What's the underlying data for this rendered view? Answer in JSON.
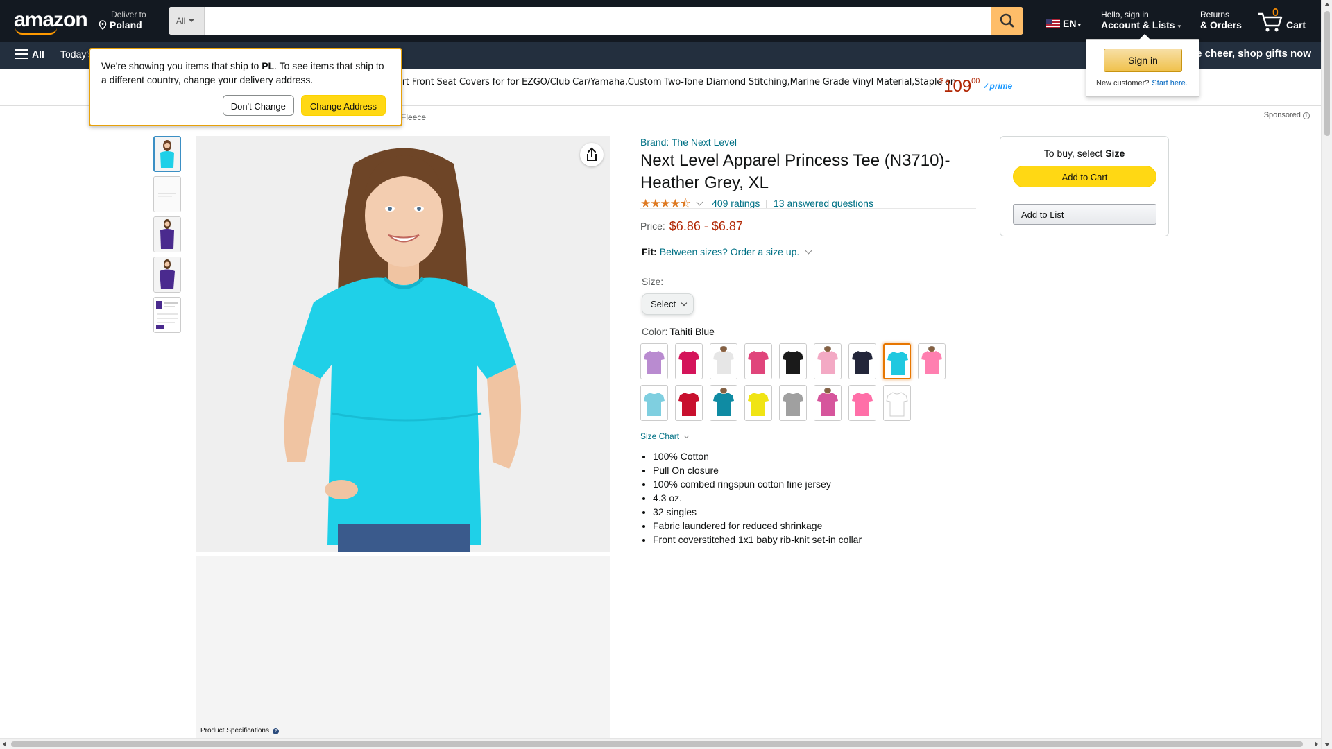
{
  "header": {
    "logo_text": "amazon",
    "deliver_small": "Deliver to",
    "deliver_big": "Poland",
    "search_category": "All",
    "search_placeholder": "",
    "lang": "EN",
    "account_small": "Hello, sign in",
    "account_big": "Account & Lists",
    "returns_small": "Returns",
    "returns_big": "& Orders",
    "cart_count": "0",
    "cart_label": "Cart"
  },
  "nav": {
    "all_label": "All",
    "today_label": "Today's",
    "promo_text": "Spread the cheer, shop gifts now"
  },
  "ad": {
    "text": "art Front Seat Covers for for EZGO/Club Car/Yamaha,Custom Two-Tone Diamond Stitching,Marine Grade Vinyl Material,Staple on",
    "price_whole": "109",
    "price_fraction": "00",
    "currency": "$",
    "prime_label": "prime",
    "sponsored_label": "Sponsored"
  },
  "breadcrumb_fragment": "Fleece",
  "tooltip": {
    "text_before": "We're showing you items that ship to ",
    "country": "PL",
    "text_after": ". To see items that ship to a different country, change your delivery address.",
    "dont_change": "Don't Change",
    "change_address": "Change Address"
  },
  "signin_popup": {
    "button": "Sign in",
    "new_customer": "New customer?",
    "start_here": "Start here."
  },
  "product": {
    "brand": "Brand: The Next Level",
    "title": "Next Level Apparel Princess Tee (N3710)- Heather Grey, XL",
    "rating_stars": "4.5",
    "ratings_count": "409 ratings",
    "answered": "13 answered questions",
    "price_label": "Price:",
    "price_value": "$6.86 - $6.87",
    "fit_label": "Fit:",
    "fit_text": "Between sizes? Order a size up.",
    "size_label": "Size:",
    "size_select": "Select",
    "color_label": "Color:",
    "color_value": "Tahiti Blue",
    "size_chart": "Size Chart",
    "bullets": [
      "100% Cotton",
      "Pull On closure",
      "100% combed ringspun cotton fine jersey",
      "4.3 oz.",
      "32 singles",
      "Fabric laundered for reduced shrinkage",
      "Front coverstitched 1x1 baby rib-knit set-in collar"
    ],
    "product_specifications": "Product Specifications",
    "swatch_colors": [
      "#b98bd0",
      "#d4145a",
      "#e6e6e6",
      "#e0457b",
      "#1a1a1a",
      "#f3a9c4",
      "#23263a",
      "#1fc8e0",
      "#ff7fb0",
      "#7fcfe0",
      "#c8102e",
      "#0f8ba3",
      "#f0e414",
      "#a0a0a0",
      "#d6559c",
      "#ff6fa8",
      "#ffffff"
    ],
    "selected_swatch_index": 7,
    "thumb_colors": [
      "#1fd0e8",
      "#f4f4f4",
      "#4a2a8e",
      "#4a2a8e",
      "#e8e8f0"
    ],
    "main_shirt_color": "#1fd0e8"
  },
  "buybox": {
    "to_buy": "To buy, select ",
    "to_buy_bold": "Size",
    "add_to_cart": "Add to Cart",
    "add_to_list": "Add to List"
  }
}
